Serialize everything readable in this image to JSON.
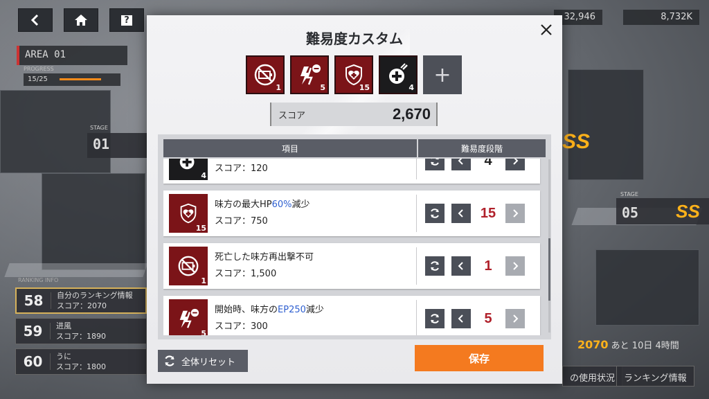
{
  "hud": {
    "back_icon": "chevron-left-icon",
    "home_icon": "home-icon",
    "help_label": "?",
    "currency1": "32,946",
    "currency2": "8,732K"
  },
  "map": {
    "area_title": "AREA 01",
    "progress_label": "PROGRESS",
    "progress_value": "15/25",
    "stage_label": "STAGE",
    "stage_left": "01",
    "stage_right": "05",
    "rank_left": "SS",
    "rank_right": "SS",
    "ranking_header": "RANKING INFO",
    "ranking": [
      {
        "rank": "58",
        "name": "自分のランキング情報",
        "score": "スコア：2070"
      },
      {
        "rank": "59",
        "name": "进風",
        "score": "スコア：1890"
      },
      {
        "rank": "60",
        "name": "うに",
        "score": "スコア：1800"
      }
    ],
    "event_score": "2070",
    "event_remaining": "あと 10日 4時間",
    "usage_label": "の使用状況",
    "ranking_info_button": "ランキング情報"
  },
  "dialog": {
    "title": "難易度カスタム",
    "active_modifiers": [
      {
        "icon": "no-battery-icon",
        "count": "1"
      },
      {
        "icon": "lightning-minus-icon",
        "count": "5"
      },
      {
        "icon": "heart-shield-icon",
        "count": "15"
      },
      {
        "icon": "heal-plus-icon",
        "count": "4"
      }
    ],
    "add_label": "+",
    "score_label": "スコア",
    "score_value": "2,670",
    "col_item": "項目",
    "col_level": "難易度段階",
    "rows": [
      {
        "icon": "heal-plus-icon",
        "count": "4",
        "title_pre": "",
        "title_hl": "",
        "title_post": "",
        "score": "スコア：120",
        "level": "4"
      },
      {
        "icon": "heart-shield-icon",
        "count": "15",
        "title_pre": "味方の最大HP",
        "title_hl": "60%",
        "title_post": "減少",
        "score": "スコア：750",
        "level": "15"
      },
      {
        "icon": "no-battery-icon",
        "count": "1",
        "title_pre": "死亡した味方再出撃不可",
        "title_hl": "",
        "title_post": "",
        "score": "スコア：1,500",
        "level": "1"
      },
      {
        "icon": "lightning-minus-icon",
        "count": "5",
        "title_pre": "開始時、味方の",
        "title_hl": "EP250",
        "title_post": "減少",
        "score": "スコア：300",
        "level": "5"
      }
    ],
    "reset_label": "全体リセット",
    "save_label": "保存"
  }
}
